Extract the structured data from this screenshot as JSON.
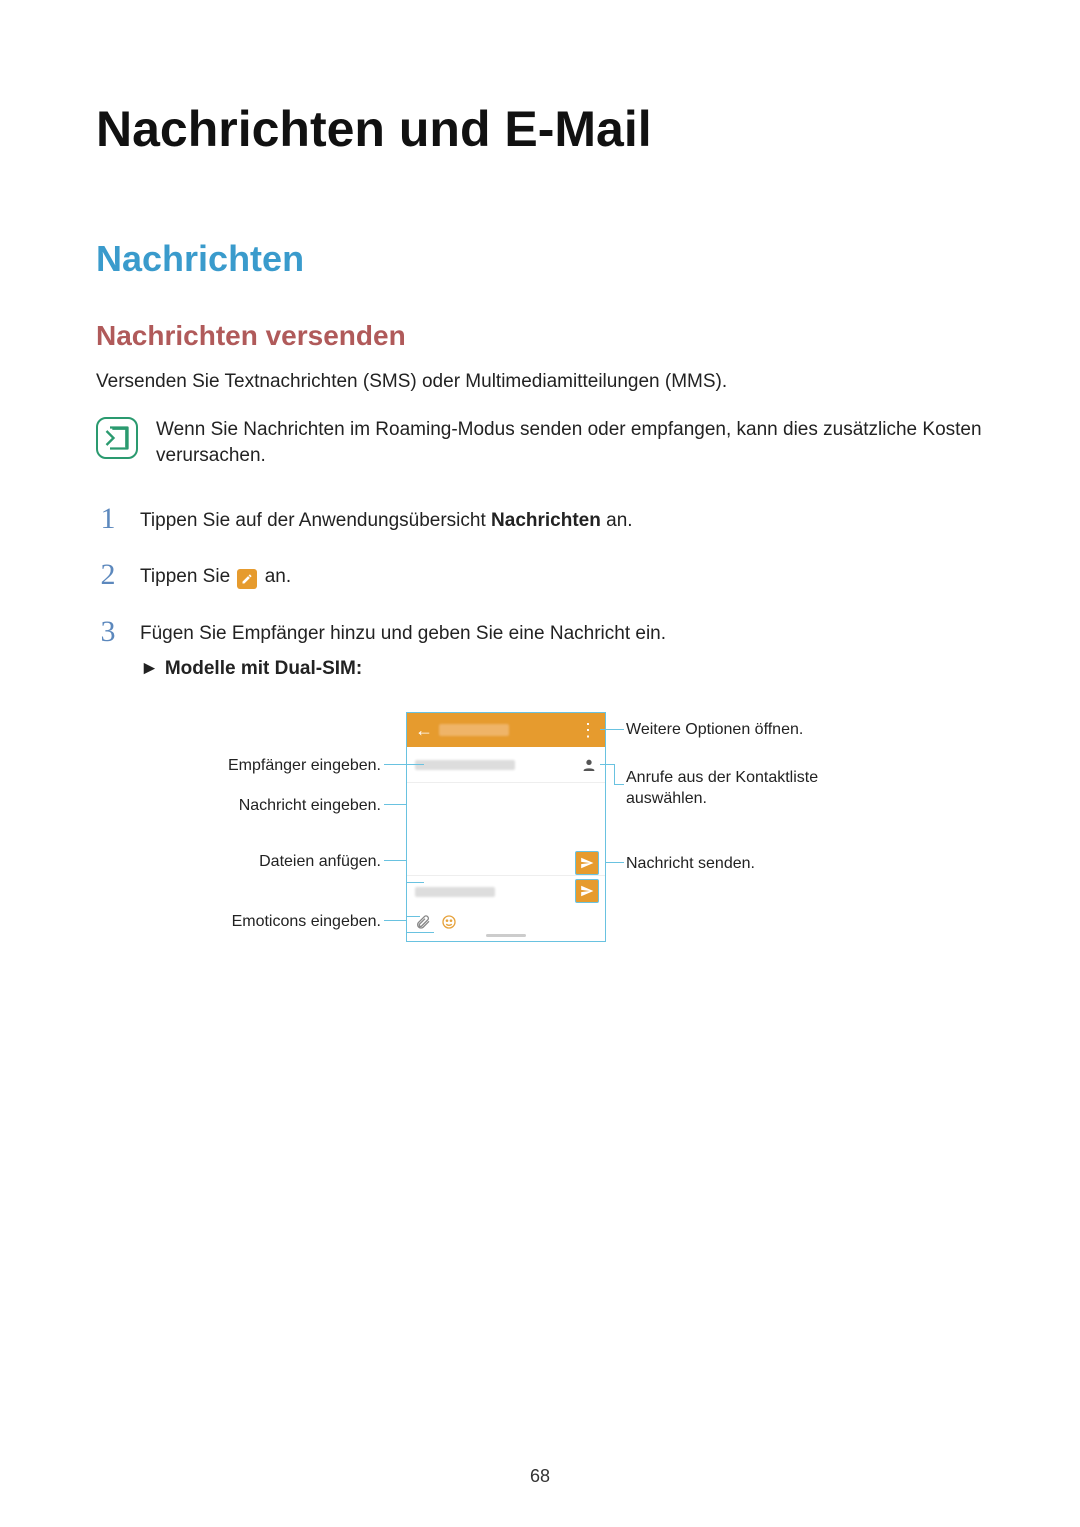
{
  "page_title": "Nachrichten und E-Mail",
  "section_title": "Nachrichten",
  "subsection_title": "Nachrichten versenden",
  "intro": "Versenden Sie Textnachrichten (SMS) oder Multimediamitteilungen (MMS).",
  "note": "Wenn Sie Nachrichten im Roaming-Modus senden oder empfangen, kann dies zusätzliche Kosten verursachen.",
  "steps": {
    "1": {
      "num": "1",
      "before": "Tippen Sie auf der Anwendungsübersicht ",
      "bold": "Nachrichten",
      "after": " an."
    },
    "2": {
      "num": "2",
      "before": "Tippen Sie ",
      "after": " an."
    },
    "3": {
      "num": "3",
      "text": "Fügen Sie Empfänger hinzu und geben Sie eine Nachricht ein.",
      "sub_arrow": "►",
      "sub_bold": "Modelle mit Dual-SIM",
      "sub_colon": ":"
    }
  },
  "callouts": {
    "left1": "Empfänger eingeben.",
    "left2": "Nachricht eingeben.",
    "left3": "Dateien anfügen.",
    "left4": "Emoticons eingeben.",
    "right1": "Weitere Optionen öffnen.",
    "right2": "Anrufe aus der Kontaktliste auswählen.",
    "right3": "Nachricht senden."
  },
  "page_number": "68"
}
